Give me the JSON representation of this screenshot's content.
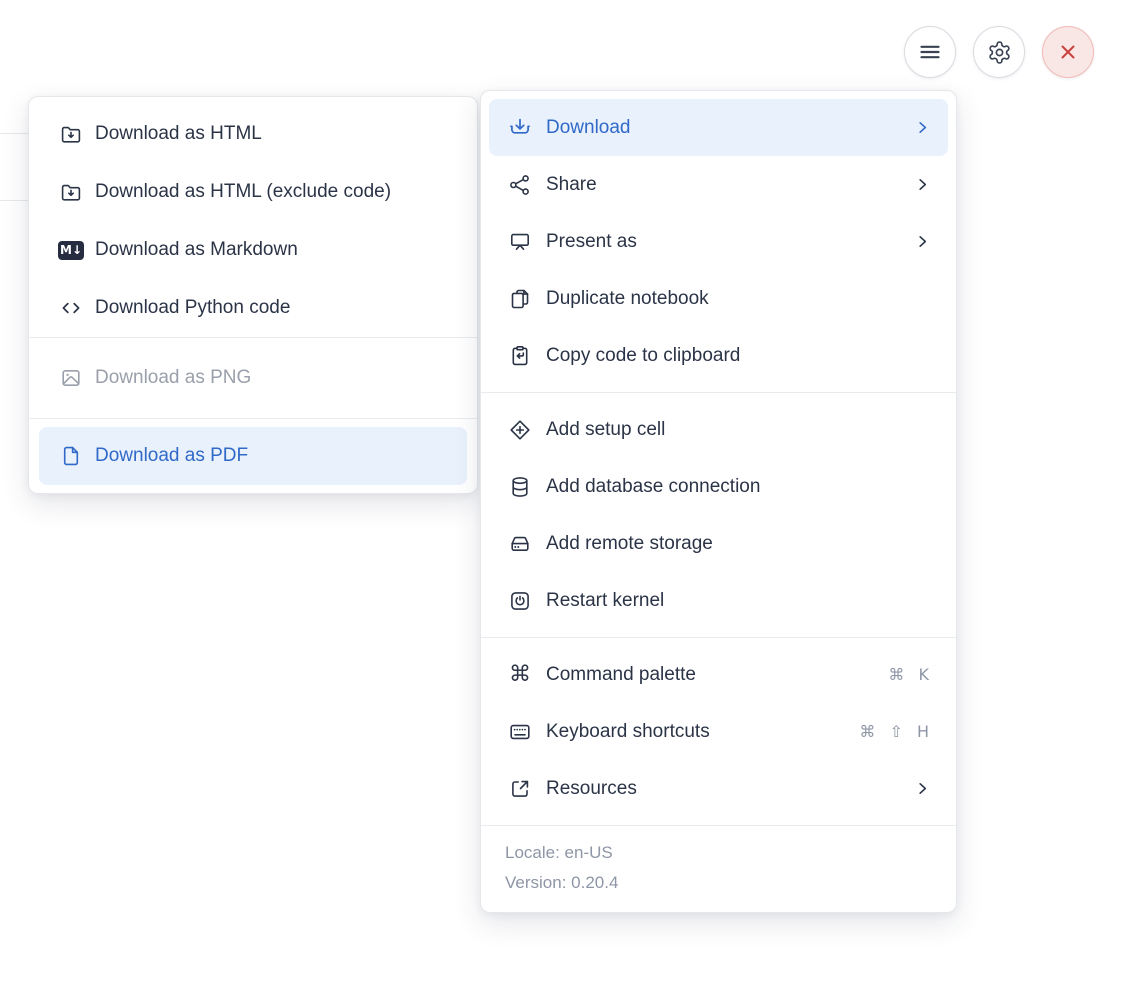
{
  "colors": {
    "accent_blue": "#3069c8",
    "highlight_bg": "#e9f1fc",
    "text_dark": "#2b3447",
    "text_muted": "#8e96a6",
    "disabled_text": "#9aa0ab",
    "danger_red": "#c9413c",
    "danger_bg": "#f9e7e6"
  },
  "toolbar": {
    "buttons": [
      {
        "icon": "hamburger-icon"
      },
      {
        "icon": "gear-icon"
      },
      {
        "icon": "close-icon"
      }
    ]
  },
  "submenu": {
    "markdown_badge": "M↓",
    "items": [
      {
        "label": "Download as HTML",
        "icon": "folder-download-icon",
        "state": "normal"
      },
      {
        "label": "Download as HTML (exclude code)",
        "icon": "folder-download-icon",
        "state": "normal"
      },
      {
        "label": "Download as Markdown",
        "icon": "markdown-icon",
        "state": "normal"
      },
      {
        "label": "Download Python code",
        "icon": "code-icon",
        "state": "normal"
      },
      {
        "label": "Download as PNG",
        "icon": "image-icon",
        "state": "disabled"
      },
      {
        "label": "Download as PDF",
        "icon": "file-icon",
        "state": "highlighted"
      }
    ]
  },
  "main_menu": {
    "items": [
      {
        "label": "Download",
        "icon": "download-icon",
        "has_submenu": true,
        "state": "active"
      },
      {
        "label": "Share",
        "icon": "share-icon",
        "has_submenu": true
      },
      {
        "label": "Present as",
        "icon": "presentation-icon",
        "has_submenu": true
      },
      {
        "label": "Duplicate notebook",
        "icon": "duplicate-icon"
      },
      {
        "label": "Copy code to clipboard",
        "icon": "clipboard-arrow-icon"
      },
      {
        "label": "Add setup cell",
        "icon": "diamond-plus-icon"
      },
      {
        "label": "Add database connection",
        "icon": "database-icon"
      },
      {
        "label": "Add remote storage",
        "icon": "hard-drive-icon"
      },
      {
        "label": "Restart kernel",
        "icon": "power-icon"
      },
      {
        "label": "Command palette",
        "icon": "command-icon",
        "shortcut": "⌘ K"
      },
      {
        "label": "Keyboard shortcuts",
        "icon": "keyboard-icon",
        "shortcut": "⌘ ⇧ H"
      },
      {
        "label": "Resources",
        "icon": "external-link-icon",
        "has_submenu": true
      }
    ],
    "footer": {
      "locale": "Locale: en-US",
      "version": "Version: 0.20.4"
    }
  }
}
